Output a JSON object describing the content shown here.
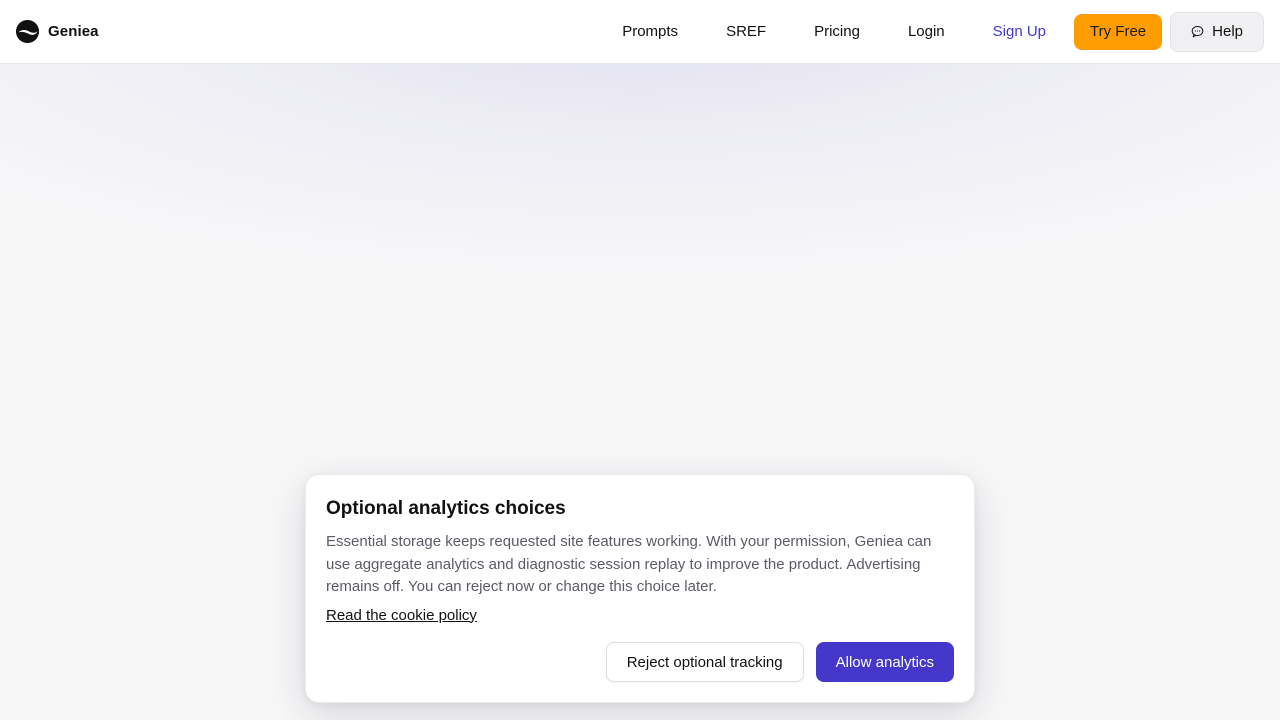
{
  "brand": {
    "name": "Geniea"
  },
  "nav": {
    "links": [
      "Prompts",
      "SREF",
      "Pricing",
      "Login"
    ],
    "signup_label": "Sign Up",
    "try_free_label": "Try Free",
    "help_label": "Help"
  },
  "consent": {
    "title": "Optional analytics choices",
    "body": "Essential storage keeps requested site features working. With your permission, Geniea can use aggregate analytics and diagnostic session replay to improve the product. Advertising remains off. You can reject now or change this choice later.",
    "policy_link": "Read the cookie policy",
    "reject_label": "Reject optional tracking",
    "allow_label": "Allow analytics"
  },
  "colors": {
    "accent": "#4338ca",
    "try_free_bg": "#ff9d00",
    "page_bg": "#f7f7f8"
  },
  "icons": {
    "brand_logo": "geniea-logo-icon",
    "help": "chat-bubble-icon"
  }
}
